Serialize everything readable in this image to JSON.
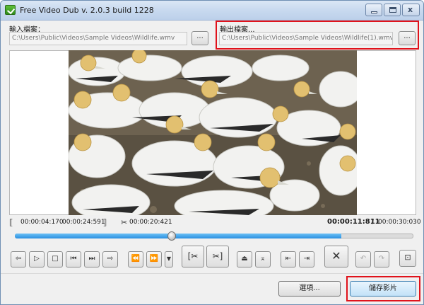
{
  "window": {
    "title": "Free Video Dub  v. 2.0.3 build 1228",
    "minimize_glyph": "",
    "maximize_glyph": "",
    "close_glyph": "x"
  },
  "input": {
    "label": "輸入檔案：",
    "path": "C:\\Users\\Public\\Videos\\Sample Videos\\Wildlife.wmv",
    "browse_label": "..."
  },
  "output": {
    "label": "輸出檔案...",
    "path": "C:\\Users\\Public\\Videos\\Sample Videos\\Wildlife(1).wmv",
    "browse_label": "..."
  },
  "timeline": {
    "selection_start": "00:00:04:170",
    "selection_end": "00:00:24:591",
    "cut_time": "00:00:20:421",
    "current_time": "00:00:11:811",
    "separator": "/",
    "total_time": "00:00:30:030",
    "progress_fraction": 0.393
  },
  "controls": {
    "icons": {
      "prev_frame": "arrow-left-icon",
      "play": "play-icon",
      "stop": "stop-icon",
      "step_back": "step-back-icon",
      "step_forward": "step-forward-icon",
      "next_frame": "arrow-right-icon",
      "go_start": "skip-start-icon",
      "go_end": "skip-end-icon",
      "mark_in": "mark-in-icon",
      "mark_out": "mark-out-icon",
      "cut": "cut-icon",
      "uncut": "uncut-icon",
      "prev_cut": "prev-cut-icon",
      "next_cut": "next-cut-icon",
      "delete": "delete-icon",
      "undo": "undo-icon",
      "redo": "redo-icon",
      "fit": "fit-window-icon"
    }
  },
  "footer": {
    "options_label": "選項...",
    "save_label": "儲存影片"
  },
  "colors": {
    "highlight": "#e0121b",
    "seek_fill": "#2a8fe0",
    "title_bar": "#c8d9ef"
  }
}
